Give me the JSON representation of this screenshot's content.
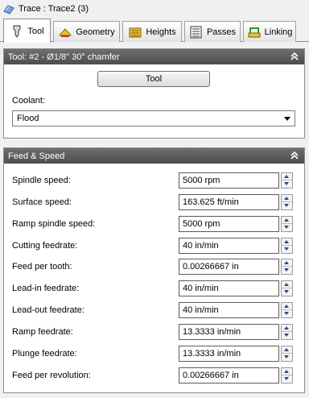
{
  "window": {
    "title": "Trace : Trace2 (3)"
  },
  "tabs": [
    {
      "label": "Tool",
      "icon": "tool-holder-icon"
    },
    {
      "label": "Geometry",
      "icon": "geometry-icon"
    },
    {
      "label": "Heights",
      "icon": "heights-icon"
    },
    {
      "label": "Passes",
      "icon": "passes-icon"
    },
    {
      "label": "Linking",
      "icon": "linking-icon"
    }
  ],
  "tool_panel": {
    "header": "Tool: #2 - Ø1/8\" 30° chamfer",
    "tool_button": "Tool",
    "coolant_label": "Coolant:",
    "coolant_value": "Flood"
  },
  "feed_panel": {
    "header": "Feed & Speed",
    "rows": [
      {
        "label": "Spindle speed:",
        "value": "5000 rpm"
      },
      {
        "label": "Surface speed:",
        "value": "163.625 ft/min"
      },
      {
        "label": "Ramp spindle speed:",
        "value": "5000 rpm"
      },
      {
        "label": "Cutting feedrate:",
        "value": "40 in/min"
      },
      {
        "label": "Feed per tooth:",
        "value": "0.00266667 in"
      },
      {
        "label": "Lead-in feedrate:",
        "value": "40 in/min"
      },
      {
        "label": "Lead-out feedrate:",
        "value": "40 in/min"
      },
      {
        "label": "Ramp feedrate:",
        "value": "13.3333 in/min"
      },
      {
        "label": "Plunge feedrate:",
        "value": "13.3333 in/min"
      },
      {
        "label": "Feed per revolution:",
        "value": "0.00266667 in"
      }
    ]
  },
  "colors": {
    "panel_header": "#5e5e5e",
    "spinner_arrow": "#2b4a86"
  }
}
